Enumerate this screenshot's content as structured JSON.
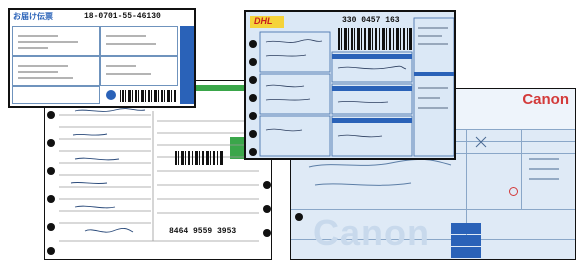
{
  "scene": {
    "description_colors": {
      "background": "#ffffff",
      "frame": "#111111",
      "japan_form_blue": "#2a62b8",
      "dhl_yellow": "#f5d33a",
      "canon_red": "#d33a3a",
      "pale_grid": "#cfe1f4"
    }
  },
  "japan_form": {
    "title": "お届け伝票",
    "tracking_number": "18-0701-55-46130"
  },
  "dhl_airwaybill": {
    "logo": "DHL",
    "waybill_number": "330 0457 163"
  },
  "fedex_form": {
    "tracking_number": "8464 9559 3953"
  },
  "canon_form": {
    "brand": "Canon",
    "watermark": "Canon"
  }
}
